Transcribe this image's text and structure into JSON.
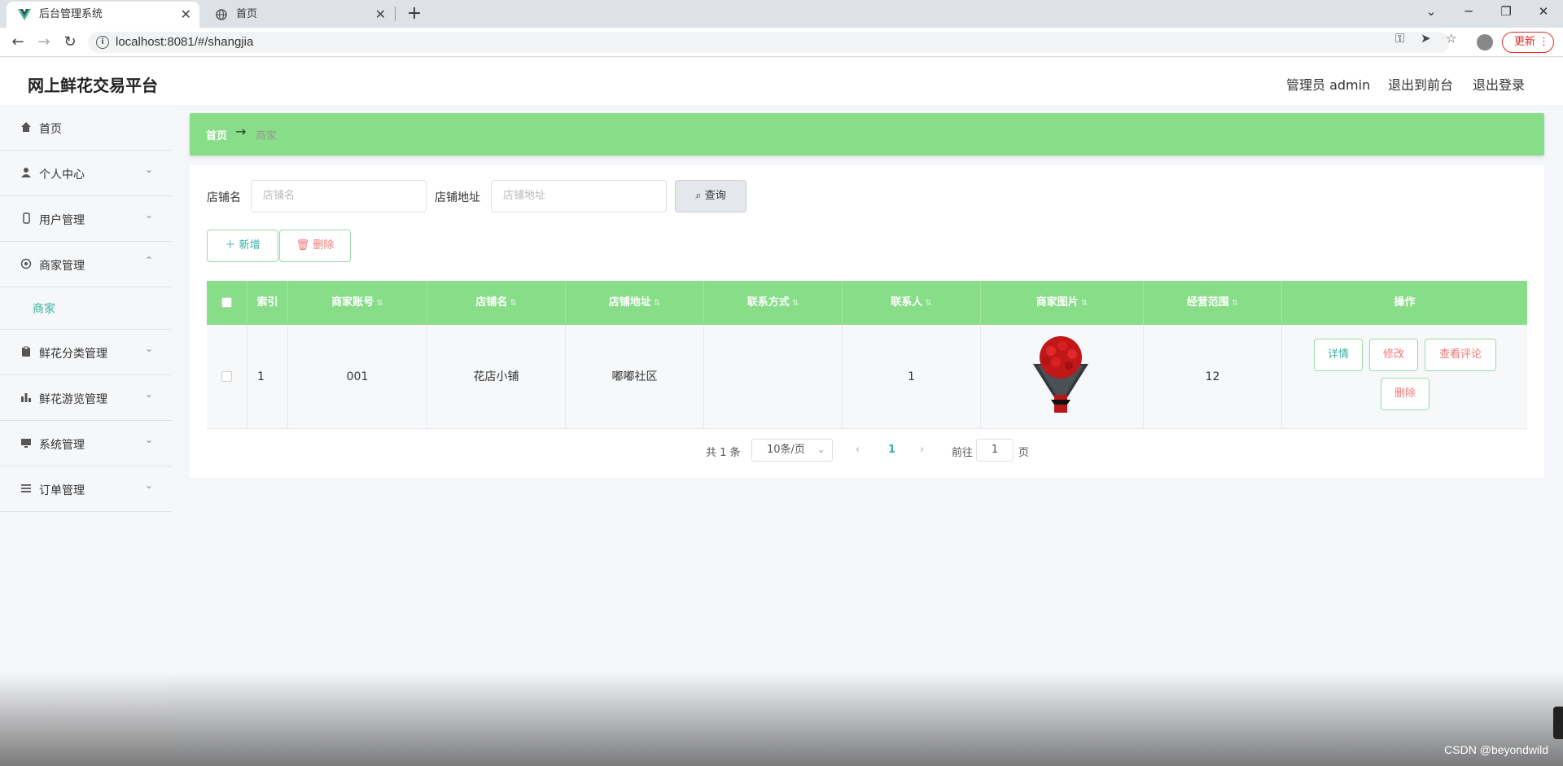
{
  "browser": {
    "tabs": [
      {
        "title": "后台管理系统",
        "active": true,
        "favicon": "vue-icon"
      },
      {
        "title": "首页",
        "active": false,
        "favicon": "globe-icon"
      }
    ],
    "url": "localhost:8081/#/shangjia",
    "update_label": "更新"
  },
  "header": {
    "brand": "网上鲜花交易平台",
    "user": "管理员 admin",
    "to_front": "退出到前台",
    "logout": "退出登录"
  },
  "sidebar": {
    "items": [
      {
        "label": "首页",
        "icon": "home-icon"
      },
      {
        "label": "个人中心",
        "icon": "user-icon"
      },
      {
        "label": "用户管理",
        "icon": "mobile-icon"
      },
      {
        "label": "商家管理",
        "icon": "gear-icon",
        "expanded": true
      },
      {
        "label": "鲜花分类管理",
        "icon": "clipboard-icon"
      },
      {
        "label": "鲜花游览管理",
        "icon": "bar-chart-icon"
      },
      {
        "label": "系统管理",
        "icon": "monitor-icon"
      },
      {
        "label": "订单管理",
        "icon": "list-icon"
      }
    ],
    "sub_active": "商家"
  },
  "breadcrumb": {
    "home": "首页",
    "arrow": "→",
    "current": "商家"
  },
  "search": {
    "shop_name_label": "店铺名",
    "shop_name_placeholder": "店铺名",
    "shop_addr_label": "店铺地址",
    "shop_addr_placeholder": "店铺地址",
    "query_label": "查询"
  },
  "actions": {
    "add": "新增",
    "delete": "删除"
  },
  "table": {
    "columns": [
      "索引",
      "商家账号",
      "店铺名",
      "店铺地址",
      "联系方式",
      "联系人",
      "商家图片",
      "经营范围",
      "操作"
    ],
    "rows": [
      {
        "index": "1",
        "account": "001",
        "shop_name": "花店小铺",
        "address": "嘟嘟社区",
        "contact": "",
        "contact_person": "1",
        "scope": "12"
      }
    ],
    "row_ops": [
      "详情",
      "修改",
      "查看评论",
      "删除"
    ]
  },
  "pagination": {
    "total": "共 1 条",
    "page_size": "10条/页",
    "current_page": "1",
    "goto_label": "前往",
    "goto_value": "1",
    "page_suffix": "页"
  },
  "watermark": "CSDN @beyondwild",
  "colors": {
    "accent_green": "#88dd88",
    "teal": "#3bb0a0",
    "danger": "#f07878"
  }
}
